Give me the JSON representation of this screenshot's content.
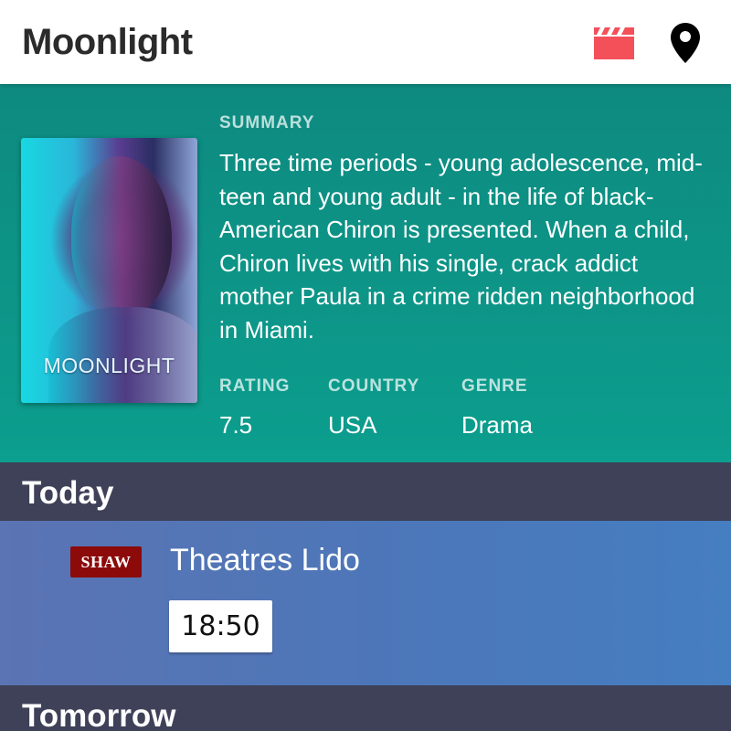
{
  "header": {
    "title": "Moonlight",
    "icons": [
      "clapperboard-icon",
      "location-pin-icon"
    ],
    "clapper_color": "#f4505a"
  },
  "movie": {
    "poster_title": "MOONLIGHT",
    "summary_label": "SUMMARY",
    "summary": "Three time periods - young adolescence, mid-teen and young adult - in the life of black-American Chiron is presented. When a child, Chiron lives with his single, crack addict mother Paula in a crime ridden neighborhood in Miami.",
    "rating_label": "RATING",
    "rating": "7.5",
    "country_label": "COUNTRY",
    "country": "USA",
    "genre_label": "GENRE",
    "genre": "Drama",
    "hero_color": "#0e8f84"
  },
  "schedule": {
    "today_label": "Today",
    "tomorrow_label": "Tomorrow",
    "today": [
      {
        "brand_badge": "SHAW",
        "cinema": "Theatres Lido",
        "times": [
          "18:50"
        ]
      }
    ],
    "day_header_color": "#3e4158",
    "badge_color": "#8c0a0a"
  }
}
